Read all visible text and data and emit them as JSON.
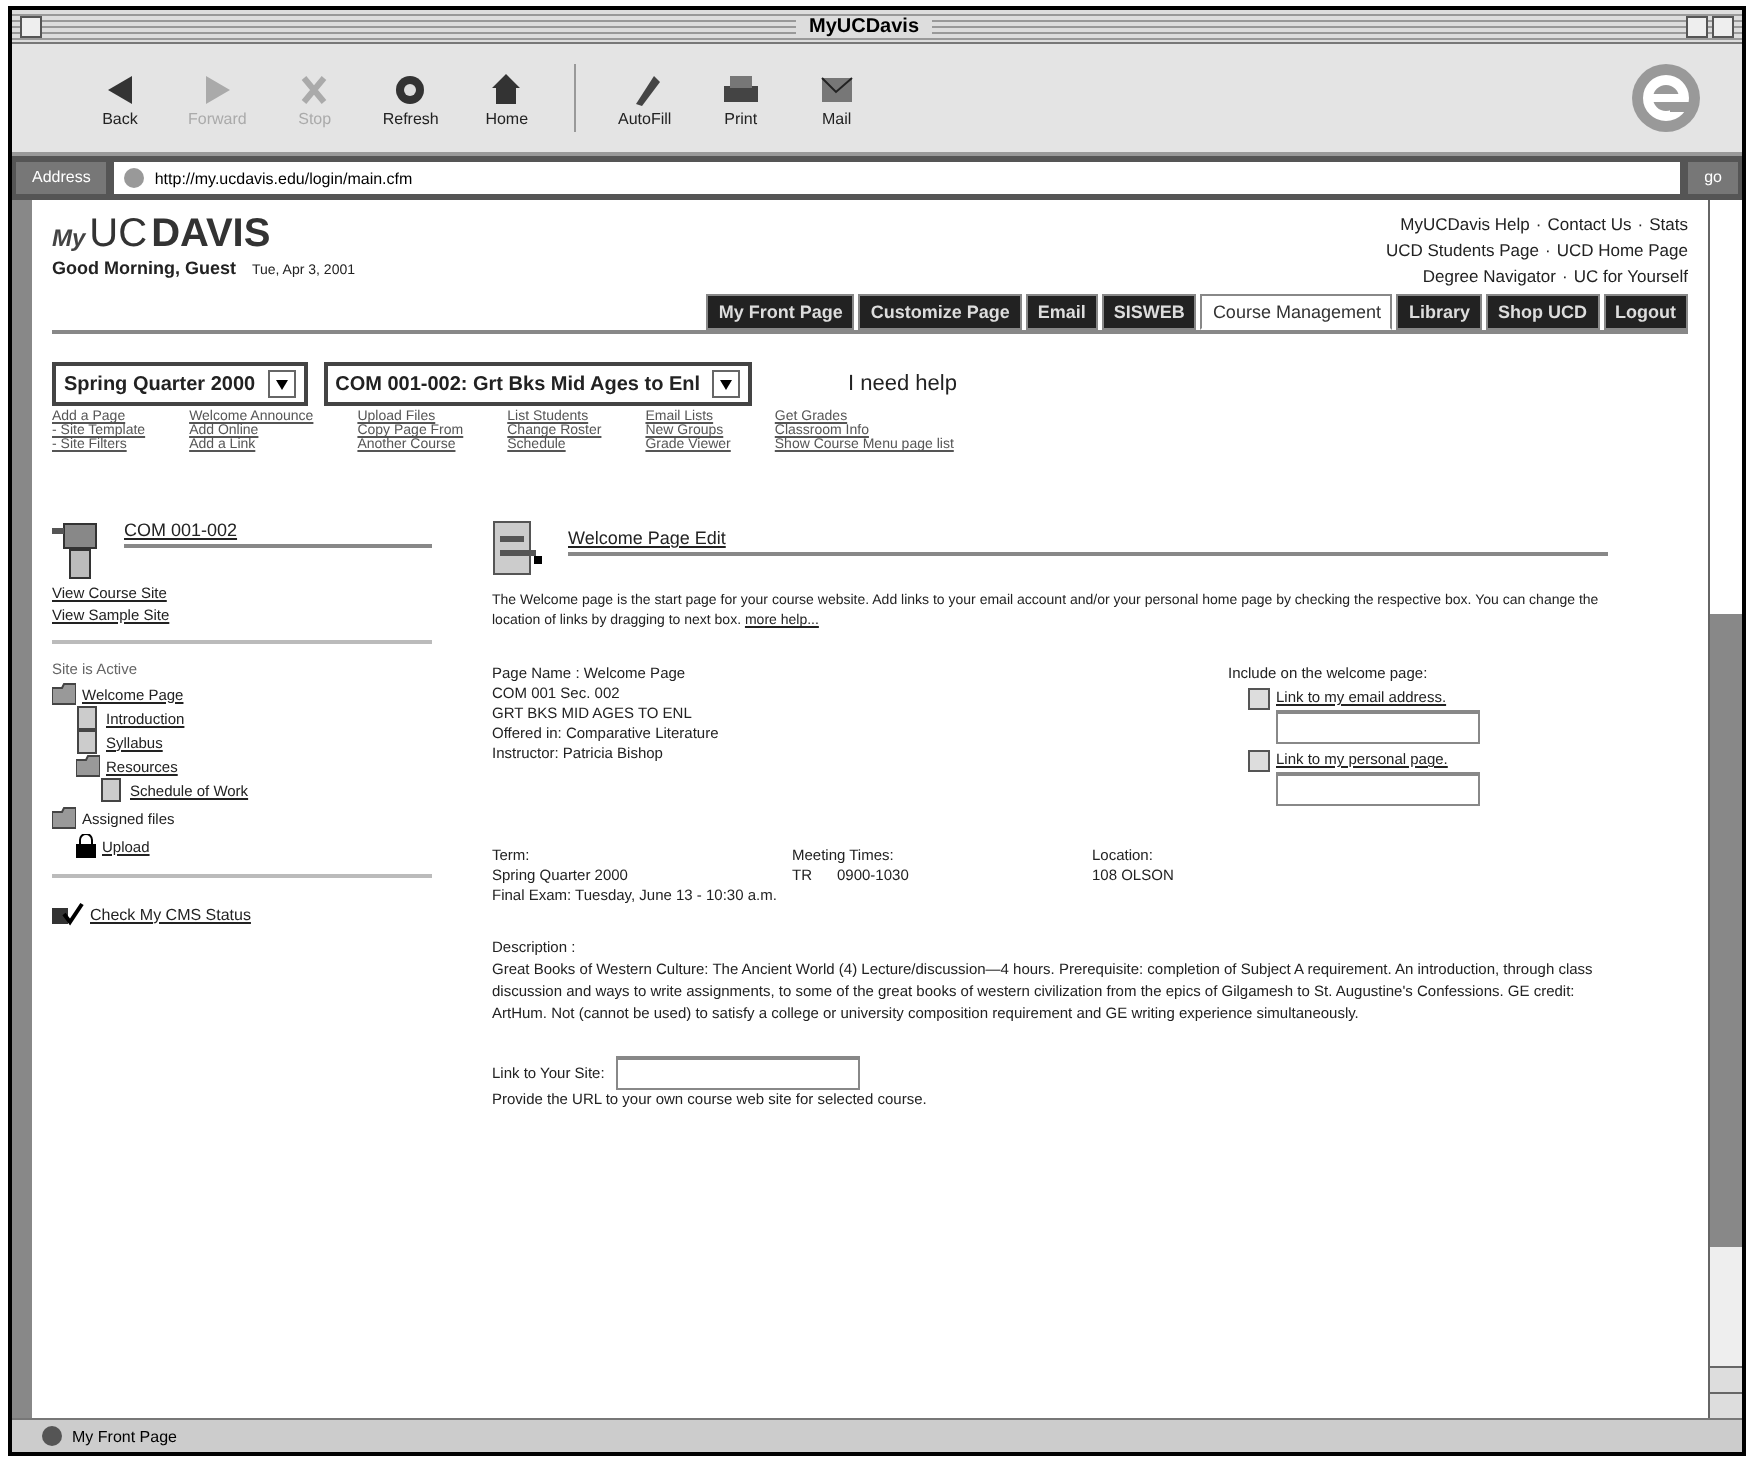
{
  "window": {
    "title": "MyUCDavis"
  },
  "toolbar": [
    {
      "label": "Back",
      "disabled": false,
      "kind": "back"
    },
    {
      "label": "Forward",
      "disabled": true,
      "kind": "forward"
    },
    {
      "label": "Stop",
      "disabled": true,
      "kind": "stop"
    },
    {
      "label": "Refresh",
      "disabled": false,
      "kind": "refresh"
    },
    {
      "label": "Home",
      "disabled": false,
      "kind": "home"
    },
    {
      "label": "AutoFill",
      "disabled": false,
      "kind": "autofill"
    },
    {
      "label": "Print",
      "disabled": false,
      "kind": "print"
    },
    {
      "label": "Mail",
      "disabled": false,
      "kind": "mail"
    }
  ],
  "address": {
    "label": "Address",
    "value": "http://my.ucdavis.edu/login/main.cfm",
    "go": "go"
  },
  "header": {
    "logo_my": "My",
    "logo_uc": "UC",
    "logo_davis": "DAVIS",
    "greeting": "Good Morning, Guest",
    "date": "Tue, Apr 3, 2001",
    "separator": "·",
    "links": [
      [
        "MyUCDavis Help",
        "Contact Us",
        "Stats"
      ],
      [
        "UCD Students Page",
        "UCD Home Page"
      ],
      [
        "Degree Navigator",
        "UC for Yourself"
      ]
    ]
  },
  "tabs": [
    {
      "label": "My Front Page",
      "selected": false
    },
    {
      "label": "Customize Page",
      "selected": false
    },
    {
      "label": "Email",
      "selected": false
    },
    {
      "label": "SISWEB",
      "selected": false
    },
    {
      "label": "Course Management",
      "selected": true
    },
    {
      "label": "Library",
      "selected": false
    },
    {
      "label": "Shop UCD",
      "selected": false
    },
    {
      "label": "Logout",
      "selected": false
    }
  ],
  "selectors": [
    {
      "value": "Spring Quarter 2000"
    },
    {
      "value": "COM 001-002: Grt Bks Mid Ages to Enl"
    }
  ],
  "help": "I need help",
  "menu_columns": [
    [
      "Add a Page",
      "- Site Template",
      "- Site Filters"
    ],
    [
      "Welcome Announce",
      "Add Online",
      "Add a Link"
    ],
    [
      "Upload Files",
      "Copy Page From",
      "Another Course"
    ],
    [
      "List Students",
      "Change Roster",
      "Schedule"
    ],
    [
      "Email Lists",
      "New Groups",
      "Grade Viewer"
    ],
    [
      "Get Grades",
      "Classroom Info",
      "Show Course Menu page list"
    ]
  ],
  "sidebar": {
    "course": "COM 001-002",
    "links": [
      "View Course Site",
      "View Sample Site"
    ],
    "status": "Site is Active",
    "tree": [
      {
        "label": "Welcome Page",
        "children": [
          {
            "label": "Introduction"
          },
          {
            "label": "Syllabus"
          },
          {
            "label": "Resources",
            "children": [
              {
                "label": "Schedule of Work"
              }
            ]
          }
        ]
      }
    ],
    "files_title": "Assigned files",
    "files": [
      "Upload"
    ],
    "cms_status": "Check My CMS Status"
  },
  "main": {
    "title": "Welcome Page Edit",
    "intro": "The Welcome page is the start page for your course website. Add links to your email account and/or your personal home page by checking the respective box. You can change the location of links by dragging to next box.",
    "more_help": "more help...",
    "info": [
      "Page Name :  Welcome Page",
      "COM 001 Sec. 002",
      "GRT BKS MID AGES TO ENL",
      "Offered in: Comparative Literature",
      "Instructor:  Patricia Bishop"
    ],
    "include_title": "Include on the welcome page:",
    "include": [
      {
        "label": "Link to my email address.",
        "checked": false
      },
      {
        "label": "Link to my personal page.",
        "checked": false
      }
    ],
    "term": [
      {
        "heading": "Term:",
        "lines": [
          "Spring Quarter 2000",
          "Final Exam: Tuesday, June 13 - 10:30 a.m."
        ]
      },
      {
        "heading": "Meeting Times:",
        "lines": [
          "TR      0900-1030"
        ]
      },
      {
        "heading": "Location:",
        "lines": [
          "108 OLSON"
        ]
      }
    ],
    "description_label": "Description :",
    "description": "Great Books of Western Culture: The Ancient World (4) Lecture/discussion—4 hours. Prerequisite: completion of Subject A requirement. An introduction, through class discussion and ways to write assignments, to some of the great books of western civilization from the epics of Gilgamesh to St. Augustine's Confessions. GE credit: ArtHum. Not (cannot be used) to satisfy a college or university composition requirement and GE writing experience simultaneously.",
    "site_label": "Link to Your Site:",
    "site_hint": "Provide the URL to your own course web site for selected course."
  },
  "status_bar": "My Front Page"
}
